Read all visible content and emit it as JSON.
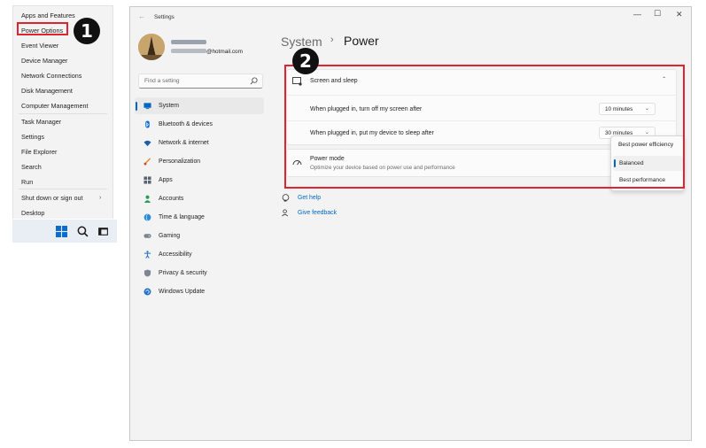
{
  "winx_menu": {
    "items": [
      {
        "label": "Apps and Features"
      },
      {
        "label": "Power Options"
      },
      {
        "label": "Event Viewer"
      },
      {
        "label": "Device Manager"
      },
      {
        "label": "Network Connections"
      },
      {
        "label": "Disk Management"
      },
      {
        "label": "Computer Management"
      },
      {
        "label": "Task Manager"
      },
      {
        "label": "Settings"
      },
      {
        "label": "File Explorer"
      },
      {
        "label": "Search"
      },
      {
        "label": "Run"
      },
      {
        "label": "Shut down or sign out"
      },
      {
        "label": "Desktop"
      }
    ],
    "highlighted": "Power Options"
  },
  "step_badges": [
    "1",
    "2"
  ],
  "taskbar": {
    "icons": [
      "windows-start-icon",
      "search-icon",
      "task-view-icon"
    ]
  },
  "settings": {
    "window_title": "Settings",
    "controls": {
      "minimize": "—",
      "maximize": "☐",
      "close": "✕"
    },
    "account": {
      "email": "@hotmail.com"
    },
    "search": {
      "placeholder": "Find a setting"
    },
    "nav": [
      {
        "label": "System",
        "icon": "monitor-icon",
        "active": true
      },
      {
        "label": "Bluetooth & devices",
        "icon": "bluetooth-icon"
      },
      {
        "label": "Network & internet",
        "icon": "wifi-icon"
      },
      {
        "label": "Personalization",
        "icon": "brush-icon"
      },
      {
        "label": "Apps",
        "icon": "apps-icon"
      },
      {
        "label": "Accounts",
        "icon": "person-icon"
      },
      {
        "label": "Time & language",
        "icon": "globe-clock-icon"
      },
      {
        "label": "Gaming",
        "icon": "gamepad-icon"
      },
      {
        "label": "Accessibility",
        "icon": "accessibility-icon"
      },
      {
        "label": "Privacy & security",
        "icon": "shield-icon"
      },
      {
        "label": "Windows Update",
        "icon": "update-icon"
      }
    ],
    "breadcrumb": {
      "parent": "System",
      "separator": "›",
      "current": "Power"
    },
    "screen_sleep": {
      "title": "Screen and sleep",
      "rows": [
        {
          "label": "When plugged in, turn off my screen after",
          "value": "10 minutes"
        },
        {
          "label": "When plugged in, put my device to sleep after",
          "value": "30 minutes"
        }
      ]
    },
    "power_mode": {
      "title": "Power mode",
      "subtitle": "Optimize your device based on power use and performance",
      "options": [
        "Best power efficiency",
        "Balanced",
        "Best performance"
      ],
      "selected": "Balanced"
    },
    "links": {
      "help": "Get help",
      "feedback": "Give feedback"
    }
  },
  "colors": {
    "accent": "#0067c0",
    "highlight_box": "#e0242f",
    "badge": "#111111"
  }
}
